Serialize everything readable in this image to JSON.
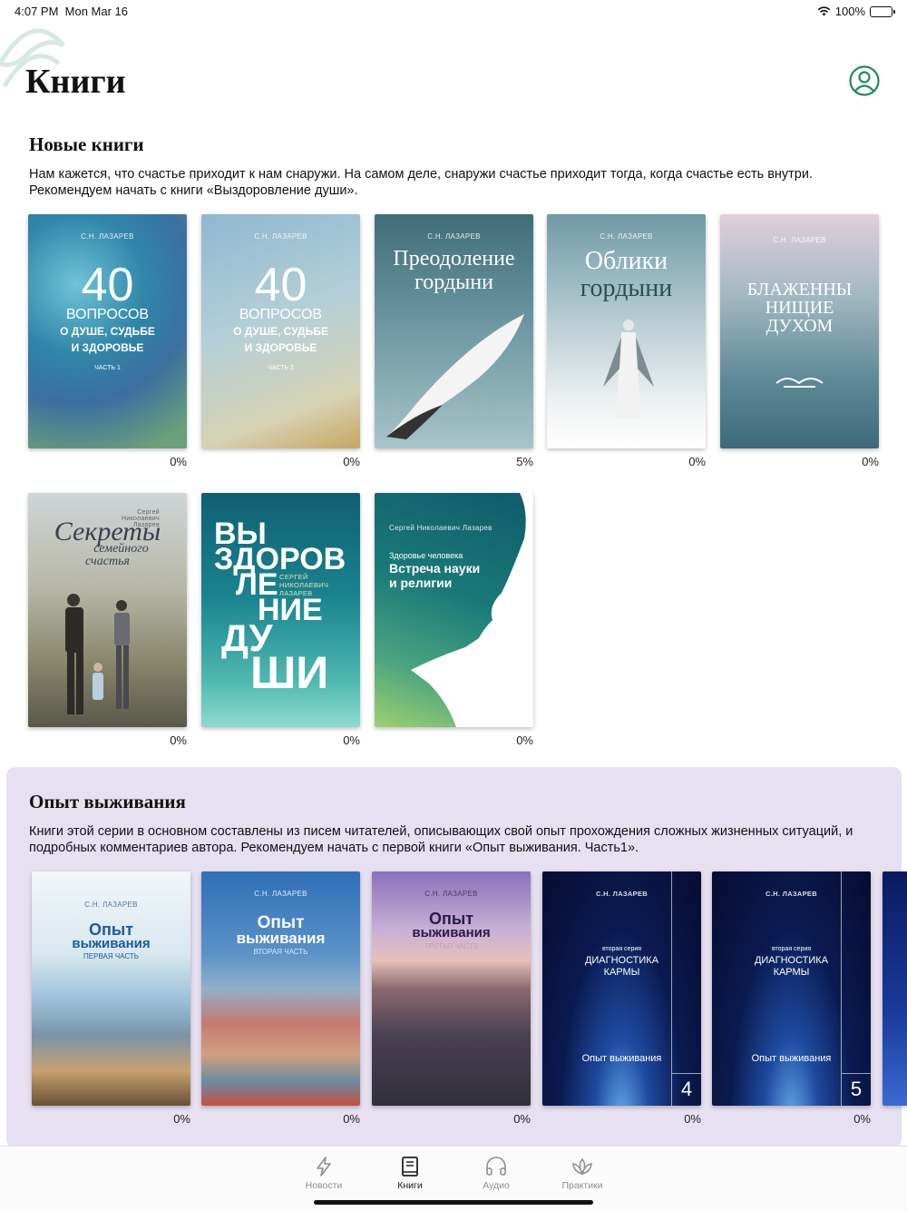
{
  "status_bar": {
    "time": "4:07 PM",
    "date": "Mon Mar 16",
    "battery": "100%"
  },
  "page_title": "Книги",
  "new_books": {
    "title": "Новые книги",
    "description": "Нам кажется, что счастье приходит к нам снаружи. На самом деле, снаружи счастье приходит тогда, когда счастье есть внутри. Рекомендуем начать с книги «Выздоровление души».",
    "books": [
      {
        "author": "С.Н. ЛАЗАРЕВ",
        "line1": "40",
        "line2": "ВОПРОСОВ",
        "line3": "О ДУШЕ, СУДЬБЕ",
        "line4": "И ЗДОРОВЬЕ",
        "part": "ЧАСТЬ 1",
        "progress": "0%"
      },
      {
        "author": "С.Н. ЛАЗАРЕВ",
        "line1": "40",
        "line2": "ВОПРОСОВ",
        "line3": "О ДУШЕ, СУДЬБЕ",
        "line4": "И ЗДОРОВЬЕ",
        "part": "ЧАСТЬ 2",
        "progress": "0%"
      },
      {
        "author": "С.Н. ЛАЗАРЕВ",
        "line1": "Преодоление",
        "line2": "гордыни",
        "progress": "5%"
      },
      {
        "author": "С.Н. ЛАЗАРЕВ",
        "line1": "Облики",
        "line2": "гордыни",
        "progress": "0%"
      },
      {
        "author": "С.Н. ЛАЗАРЕВ",
        "line1": "БЛАЖЕННЫ",
        "line2": "НИЩИЕ",
        "line3": "ДУХОМ",
        "progress": "0%"
      },
      {
        "author": "Сергей Николаевич Лазарев",
        "line1": "Секреты",
        "line2": "семейного",
        "line3": "счастья",
        "progress": "0%"
      },
      {
        "author": "СЕРГЕЙ НИКОЛАЕВИЧ ЛАЗАРЕВ",
        "line1": "ВЫ",
        "line2": "ЗДОРОВ",
        "line3": "ЛЕ",
        "line4": "НИЕ",
        "line5": "ДУ",
        "line6": "ШИ",
        "progress": "0%"
      },
      {
        "author": "Сергей Николаевич Лазарев",
        "subtitle": "Здоровье человека",
        "line1": "Встреча науки",
        "line2": "и религии",
        "progress": "0%"
      }
    ]
  },
  "survival": {
    "title": "Опыт выживания",
    "description": "Книги этой серии в основном составлены из писем читателей, описывающих свой опыт прохождения сложных жизненных ситуаций, и подробных комментариев автора. Рекомендуем начать с первой книги «Опыт выживания. Часть1».",
    "books": [
      {
        "author": "С.Н. ЛАЗАРЕВ",
        "line1": "Опыт",
        "line2": "выживания",
        "part": "ПЕРВАЯ ЧАСТЬ",
        "progress": "0%"
      },
      {
        "author": "С.Н. ЛАЗАРЕВ",
        "line1": "Опыт",
        "line2": "выживания",
        "part": "ВТОРАЯ ЧАСТЬ",
        "progress": "0%"
      },
      {
        "author": "С.Н. ЛАЗАРЕВ",
        "line1": "Опыт",
        "line2": "выживания",
        "part": "ТРЕТЬЯ ЧАСТЬ",
        "progress": "0%"
      },
      {
        "author": "С.Н. ЛАЗАРЕВ",
        "series": "вторая серия",
        "line1": "ДИАГНОСТИКА",
        "line2": "КАРМЫ",
        "bottom": "Опыт выживания",
        "number": "4",
        "progress": "0%"
      },
      {
        "author": "С.Н. ЛАЗАРЕВ",
        "series": "вторая серия",
        "line1": "ДИАГНОСТИКА",
        "line2": "КАРМЫ",
        "bottom": "Опыт выживания",
        "number": "5",
        "progress": "0%"
      }
    ]
  },
  "tab_bar": {
    "tabs": [
      {
        "label": "Новости",
        "icon": "lightning-icon"
      },
      {
        "label": "Книги",
        "icon": "book-icon"
      },
      {
        "label": "Аудио",
        "icon": "headphones-icon"
      },
      {
        "label": "Практики",
        "icon": "lotus-icon"
      }
    ],
    "active": "Книги"
  },
  "colors": {
    "accent": "#1f8a5e",
    "series_bg": "#e6e0f1"
  }
}
